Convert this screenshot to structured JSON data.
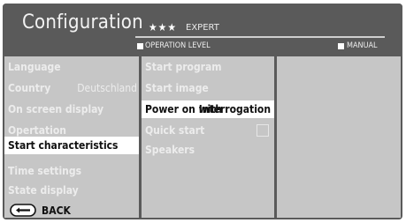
{
  "header": {
    "title": "Configuration",
    "stars": "★★★",
    "level_name": "EXPERT",
    "operation_level_label": "OPERATION LEVEL",
    "manual_label": "MANUAL"
  },
  "menu": {
    "items": [
      {
        "label": "Language",
        "value": ""
      },
      {
        "label": "Country",
        "value": "Deutschland"
      },
      {
        "label": "On screen display",
        "value": ""
      },
      {
        "label": "Opertation",
        "value": ""
      },
      {
        "label": "Start characteristics",
        "value": ""
      },
      {
        "label": "Time settings",
        "value": ""
      },
      {
        "label": "State display",
        "value": ""
      }
    ],
    "selected": "Start characteristics"
  },
  "submenu": {
    "items": [
      {
        "label": "Start program",
        "value": ""
      },
      {
        "label": "Start image",
        "value": ""
      },
      {
        "label": "Power on with",
        "value": "Interrogation"
      },
      {
        "label": "Quick start",
        "value": ""
      },
      {
        "label": "Speakers",
        "value": ""
      }
    ],
    "active": "Power on with",
    "quick_start_checked": false
  },
  "footer": {
    "back_icon": "back-button-icon",
    "back_label": "BACK"
  },
  "colors": {
    "screen_bg": "#5a5a5a",
    "panel_bg": "#c6c6c6",
    "highlight": "#ffffff",
    "dim_text": "#ececec"
  }
}
